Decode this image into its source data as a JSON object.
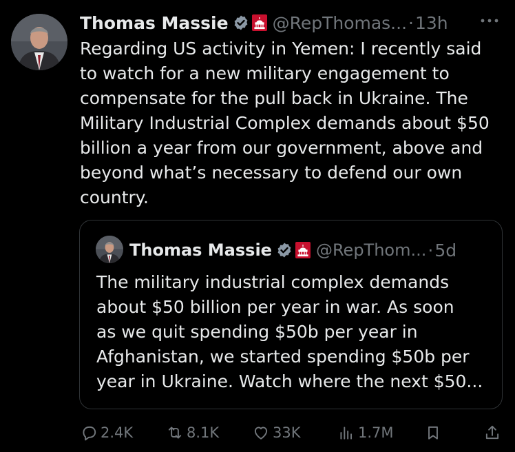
{
  "tweet": {
    "author_name": "Thomas Massie",
    "handle": "@RepThomas...",
    "separator": "·",
    "time": "13h",
    "text": "Regarding US activity in Yemen: I recently said\nto watch for a new military engagement to\ncompensate for the pull back in Ukraine. The\nMilitary Industrial Complex demands about $50\nbillion a year from our government, above and\nbeyond what’s necessary to defend our own\ncountry."
  },
  "quoted": {
    "author_name": "Thomas Massie",
    "handle": "@RepThom...",
    "separator": "·",
    "time": "5d",
    "text": "The military industrial complex demands\nabout $50 billion per year in war. As soon\nas we quit spending $50b per year in\nAfghanistan, we started spending $50b per\nyear in Ukraine. Watch where the next $50..."
  },
  "actions": {
    "replies": "2.4K",
    "reposts": "8.1K",
    "likes": "33K",
    "views": "1.7M"
  },
  "icons": {
    "verified": "verified-badge-icon",
    "affiliation": "congress-badge-icon",
    "more": "more-icon",
    "reply": "reply-icon",
    "repost": "repost-icon",
    "like": "heart-icon",
    "views": "views-icon",
    "bookmark": "bookmark-icon",
    "share": "share-icon"
  },
  "colors": {
    "background": "#000000",
    "text": "#e7e9ea",
    "secondary": "#71767b",
    "verified_blue_gray": "#8b98a5",
    "badge_red": "#c8102e",
    "border": "#2f3336"
  }
}
